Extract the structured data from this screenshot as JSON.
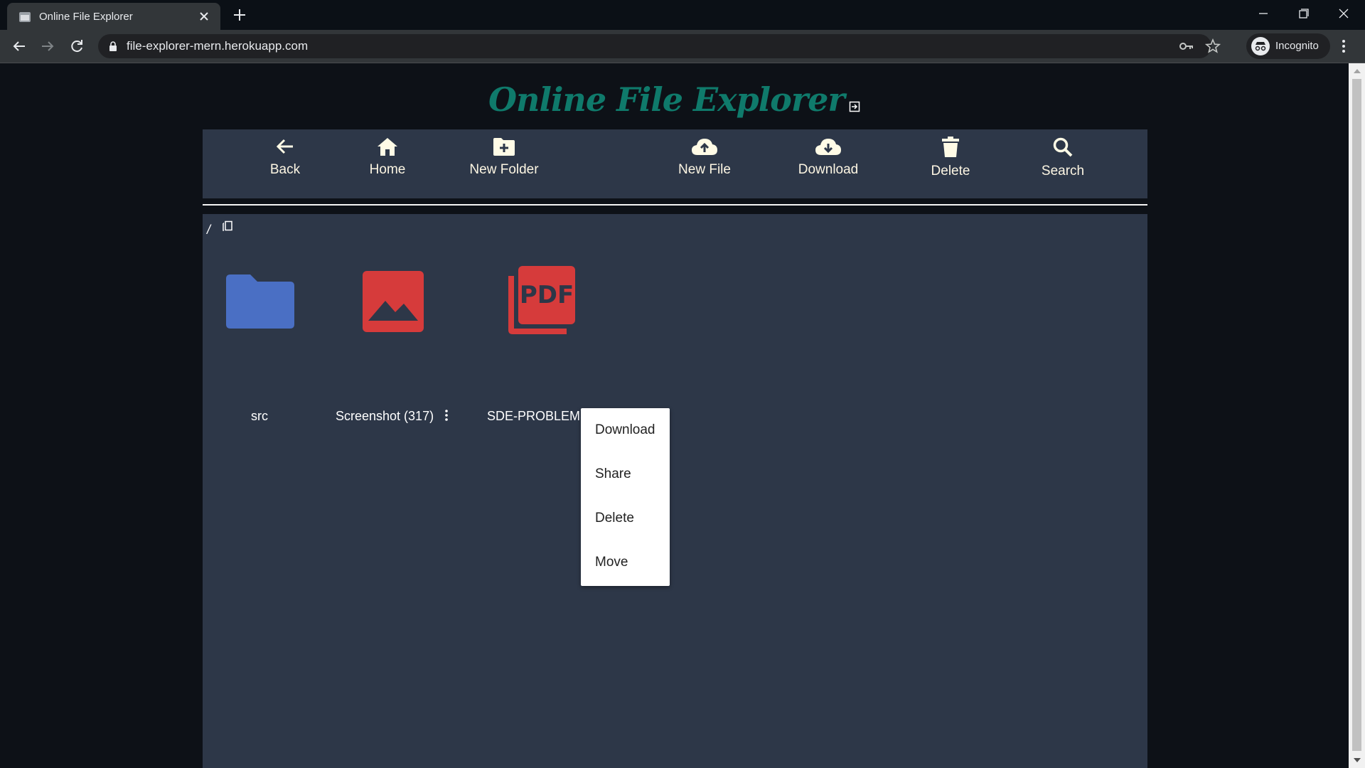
{
  "browser": {
    "tab_title": "Online File Explorer",
    "url": "file-explorer-mern.herokuapp.com",
    "profile_label": "Incognito"
  },
  "app": {
    "title": "Online File Explorer",
    "accent_color": "#0f7a6b",
    "toolbar": [
      {
        "label": "Back",
        "icon": "arrow-left-icon"
      },
      {
        "label": "Home",
        "icon": "home-icon"
      },
      {
        "label": "New Folder",
        "icon": "folder-plus-icon"
      },
      {
        "label": "New File",
        "icon": "cloud-upload-icon"
      },
      {
        "label": "Download",
        "icon": "cloud-download-icon"
      },
      {
        "label": "Delete",
        "icon": "trash-icon"
      },
      {
        "label": "Search",
        "icon": "search-icon"
      }
    ],
    "breadcrumb": "/",
    "items": [
      {
        "name": "src",
        "type": "folder",
        "icon": "folder-icon",
        "color": "#4a6fc4"
      },
      {
        "name": "Screenshot (317)",
        "type": "image",
        "icon": "image-icon",
        "color": "#d63b3b"
      },
      {
        "name": "SDE-PROBLEMS",
        "type": "pdf",
        "icon": "pdf-icon",
        "color": "#d63b3b"
      }
    ],
    "context_menu": [
      "Download",
      "Share",
      "Delete",
      "Move"
    ]
  }
}
